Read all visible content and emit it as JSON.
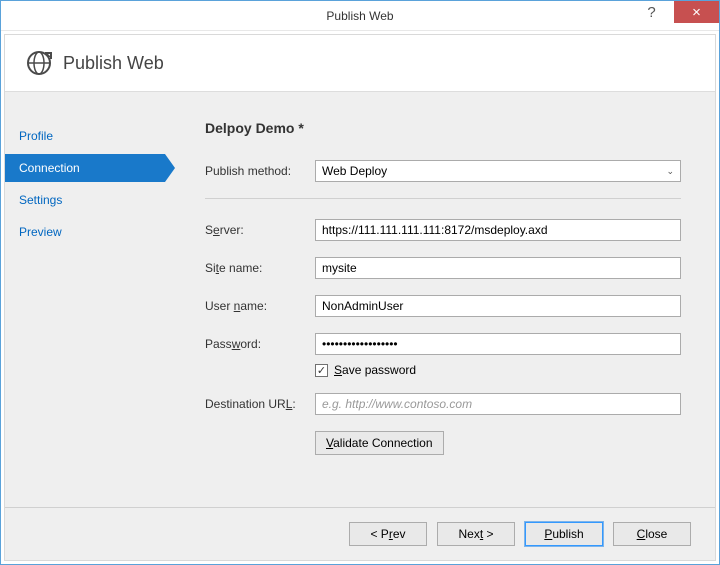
{
  "window": {
    "title": "Publish Web"
  },
  "banner": {
    "title": "Publish Web"
  },
  "sidebar": {
    "items": [
      {
        "label": "Profile",
        "active": false
      },
      {
        "label": "Connection",
        "active": true
      },
      {
        "label": "Settings",
        "active": false
      },
      {
        "label": "Preview",
        "active": false
      }
    ]
  },
  "page": {
    "title": "Delpoy Demo *"
  },
  "form": {
    "publish_method_label": "Publish method:",
    "publish_method_value": "Web Deploy",
    "server_label": "Server:",
    "server_value": "https://111.111.111.111:8172/msdeploy.axd",
    "site_name_label": "Site name:",
    "site_name_value": "mysite",
    "user_name_label": "User name:",
    "user_name_value": "NonAdminUser",
    "password_label": "Password:",
    "password_value": "••••••••••••••••••",
    "save_password_label": "Save password",
    "save_password_checked": true,
    "destination_url_label": "Destination URL:",
    "destination_url_value": "",
    "destination_url_placeholder": "e.g. http://www.contoso.com",
    "validate_label": "Validate Connection"
  },
  "footer": {
    "prev": "< Prev",
    "next": "Next >",
    "publish": "Publish",
    "close": "Close"
  }
}
